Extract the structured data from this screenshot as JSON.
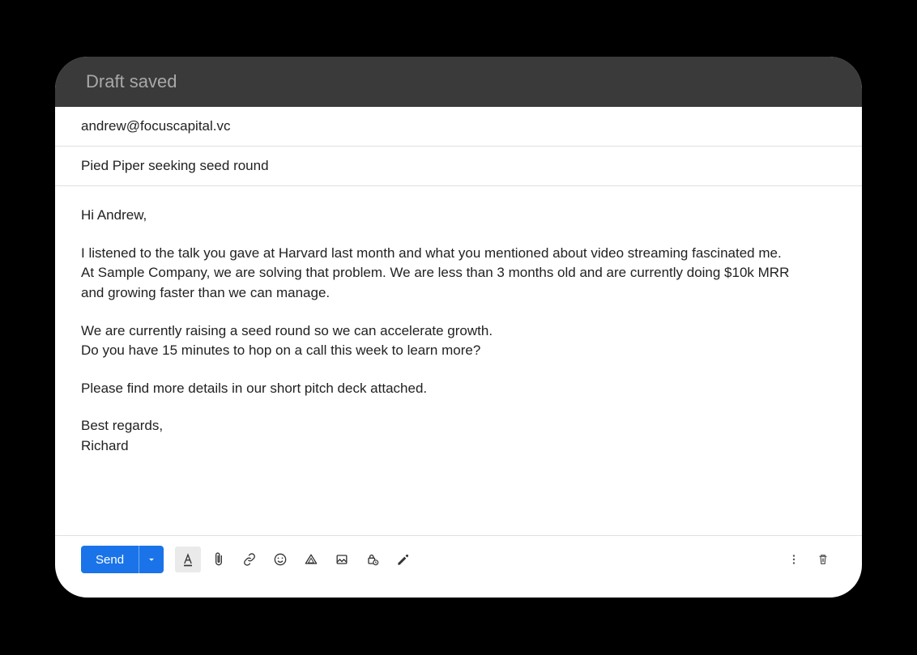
{
  "header": {
    "title": "Draft saved"
  },
  "fields": {
    "to": "andrew@focuscapital.vc",
    "subject": "Pied Piper seeking seed round"
  },
  "body": {
    "greeting": "Hi Andrew,",
    "p1_l1": "I listened to the talk you gave at Harvard last month and what you mentioned about video streaming fascinated me.",
    "p1_l2": "At Sample Company, we are solving that problem. We are less than 3 months old and are currently doing $10k MRR",
    "p1_l3": "and growing faster than we can manage.",
    "p2_l1": "We are currently raising a seed round so we can accelerate growth.",
    "p2_l2": "Do you have 15 minutes to hop on a call this week to learn more?",
    "p3": "Please find more details in our short pitch deck attached.",
    "signoff": "Best regards,",
    "name": "Richard"
  },
  "toolbar": {
    "send_label": "Send"
  }
}
